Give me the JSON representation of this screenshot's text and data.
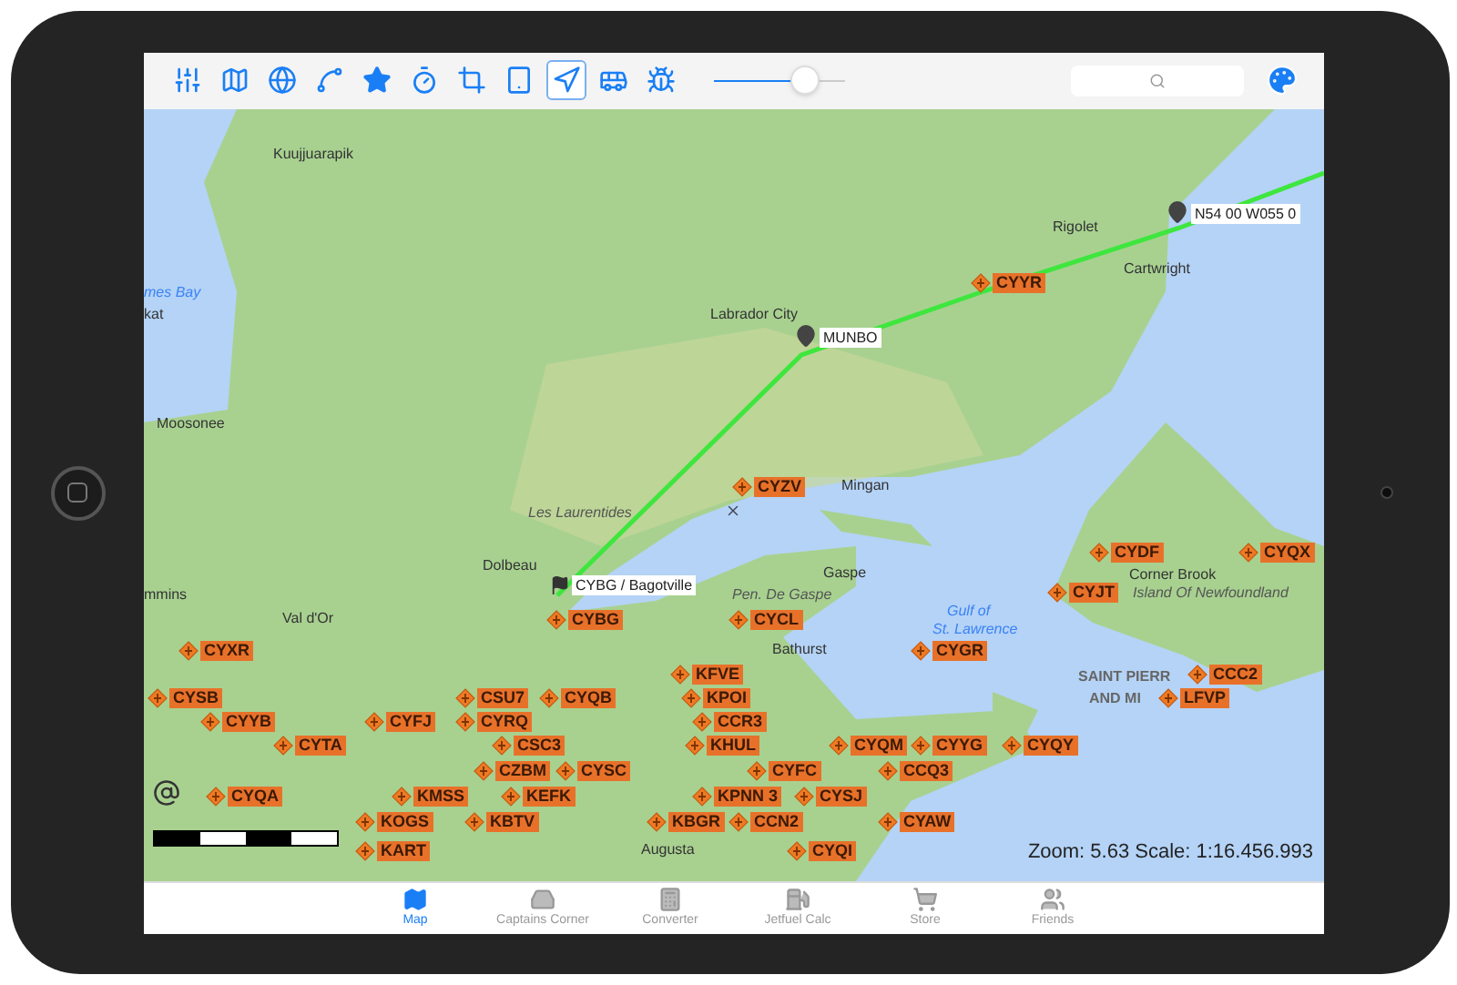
{
  "toolbar": {
    "tools": [
      {
        "selected": false
      },
      {
        "selected": false
      },
      {
        "selected": false
      },
      {
        "selected": false
      },
      {
        "selected": false
      },
      {
        "selected": false
      },
      {
        "selected": false
      },
      {
        "selected": false
      },
      {
        "selected": true
      },
      {
        "selected": false
      },
      {
        "selected": false
      }
    ],
    "zoom_slider": {
      "level": 0.7
    }
  },
  "map": {
    "place_names": [
      {
        "name": "Kuujjuarapik",
        "kind": "town"
      },
      {
        "name": "Rigolet",
        "kind": "town"
      },
      {
        "name": "Cartwright",
        "kind": "town"
      },
      {
        "name": "mes Bay",
        "kind": "water"
      },
      {
        "name": "kat",
        "kind": "town"
      },
      {
        "name": "Labrador City",
        "kind": "town"
      },
      {
        "name": "Moosonee",
        "kind": "town"
      },
      {
        "name": "Mingan",
        "kind": "town"
      },
      {
        "name": "Les Laurentides",
        "kind": "region"
      },
      {
        "name": "Dolbeau",
        "kind": "town"
      },
      {
        "name": "Gaspe",
        "kind": "town"
      },
      {
        "name": "Corner Brook",
        "kind": "town"
      },
      {
        "name": "mmins",
        "kind": "town"
      },
      {
        "name": "Pen. De Gaspe",
        "kind": "region"
      },
      {
        "name": "Island Of Newfoundland",
        "kind": "region"
      },
      {
        "name": "Val d'Or",
        "kind": "town"
      },
      {
        "name": "Gulf of",
        "kind": "water"
      },
      {
        "name": "St. Lawrence",
        "kind": "water"
      },
      {
        "name": "Bathurst",
        "kind": "town"
      },
      {
        "name": "SAINT PIERR",
        "kind": "territory"
      },
      {
        "name": "AND MI",
        "kind": "territory"
      },
      {
        "name": "Augusta",
        "kind": "town"
      }
    ],
    "airports": [
      {
        "code": "CYYR"
      },
      {
        "code": "CYZV"
      },
      {
        "code": "CYDF"
      },
      {
        "code": "CYQX"
      },
      {
        "code": "CYJT"
      },
      {
        "code": "CYBG"
      },
      {
        "code": "CYCL"
      },
      {
        "code": "CYXR"
      },
      {
        "code": "CYGR"
      },
      {
        "code": "KFVE"
      },
      {
        "code": "CCC2"
      },
      {
        "code": "CYSB"
      },
      {
        "code": "CSU7"
      },
      {
        "code": "CYQB"
      },
      {
        "code": "KPOI"
      },
      {
        "code": "LFVP"
      },
      {
        "code": "CYYB"
      },
      {
        "code": "CYFJ"
      },
      {
        "code": "CYRQ"
      },
      {
        "code": "CCR3"
      },
      {
        "code": "CYTA"
      },
      {
        "code": "CSC3"
      },
      {
        "code": "KHUL"
      },
      {
        "code": "CYQM"
      },
      {
        "code": "CYYG"
      },
      {
        "code": "CYQY"
      },
      {
        "code": "CZBM"
      },
      {
        "code": "CYSC"
      },
      {
        "code": "CYFC"
      },
      {
        "code": "CCQ3"
      },
      {
        "code": "CYQA"
      },
      {
        "code": "KMSS"
      },
      {
        "code": "KEFK"
      },
      {
        "code": "KPNN 3"
      },
      {
        "code": "CYSJ"
      },
      {
        "code": "KOGS"
      },
      {
        "code": "KBTV"
      },
      {
        "code": "KBGR"
      },
      {
        "code": "CCN2"
      },
      {
        "code": "CYAW"
      },
      {
        "code": "KART"
      },
      {
        "code": "CYQI"
      }
    ],
    "waypoints": [
      {
        "label": "N54 00 W055 0",
        "kind": "pin"
      },
      {
        "label": "MUNBO",
        "kind": "pin"
      },
      {
        "label": "CYBG / Bagotville",
        "kind": "flag"
      }
    ],
    "status": "Zoom: 5.63  Scale: 1:16.456.993"
  },
  "tab_bar": [
    {
      "label": "Map",
      "selected": true
    },
    {
      "label": "Captains Corner",
      "selected": false
    },
    {
      "label": "Converter",
      "selected": false
    },
    {
      "label": "Jetfuel Calc",
      "selected": false
    },
    {
      "label": "Store",
      "selected": false
    },
    {
      "label": "Friends",
      "selected": false
    }
  ]
}
